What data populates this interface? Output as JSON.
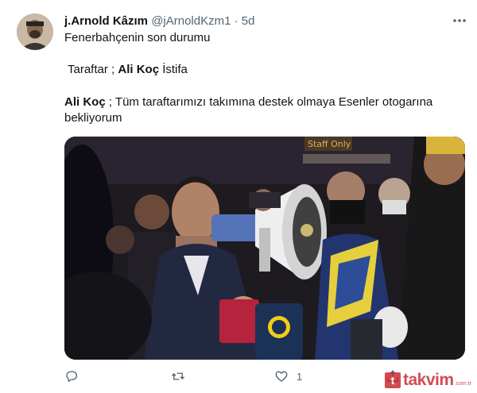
{
  "tweet": {
    "display_name": "j.Arnold Kâzım",
    "handle": "@jArnoldKzm1",
    "separator": "·",
    "time": "5d",
    "lines": {
      "l1": "Fenerbahçenin son durumu",
      "l2_prefix": "Taraftar ; ",
      "l2_bold": "Ali Koç",
      "l2_suffix": " İstifa",
      "l3_bold": "Ali Koç",
      "l3_rest": " ; Tüm taraftarımızı takımına destek olmaya Esenler otogarına",
      "l4": "bekliyorum"
    },
    "media_sign": "Staff Only",
    "actions": {
      "reply_count": "",
      "retweet_count": "",
      "like_count": "1",
      "share_count": ""
    },
    "icons": [
      "more-icon",
      "reply-icon",
      "retweet-icon",
      "like-icon",
      "share-icon"
    ]
  },
  "watermark": {
    "box": "t",
    "text": "takvim",
    "suffix": ".com.tr"
  },
  "colors": {
    "text": "#0f1419",
    "secondary": "#536471",
    "watermark": "#c51b22"
  }
}
